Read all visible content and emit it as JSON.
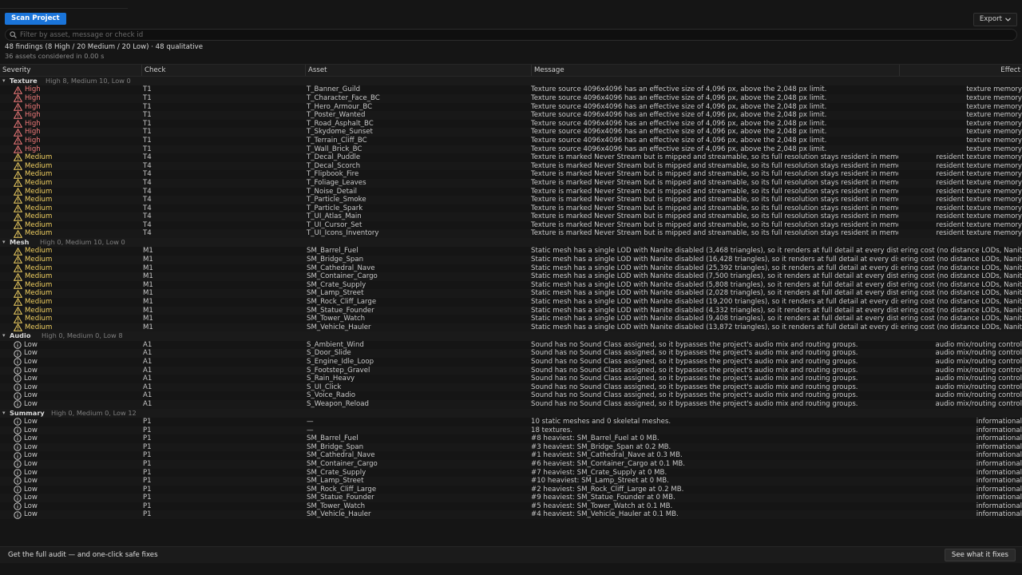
{
  "toolbar": {
    "scan_label": "Scan Project",
    "export_label": "Export"
  },
  "search": {
    "placeholder": "Filter by asset, message or check id"
  },
  "summary": {
    "line1": "48 findings (8 High / 20 Medium / 20 Low) · 48 qualitative",
    "line2": "36 assets considered in 0.00 s"
  },
  "columns": {
    "severity": "Severity",
    "check": "Check",
    "asset": "Asset",
    "message": "Message",
    "effect": "Effect"
  },
  "colors": {
    "high": "#f07a7a",
    "medium": "#f0cf60",
    "low": "#c9c9c9",
    "accent": "#1a74d9"
  },
  "groups": [
    {
      "name": "Texture",
      "counts": "High 8, Medium 10, Low 0",
      "rows": [
        {
          "severity": "High",
          "icon": "warning-triangle-icon",
          "check": "T1",
          "asset": "T_Banner_Guild",
          "message": "Texture source 4096x4096 has an effective size of 4,096 px, above the 2,048 px limit.",
          "effect": "texture memory"
        },
        {
          "severity": "High",
          "icon": "warning-triangle-icon",
          "check": "T1",
          "asset": "T_Character_Face_BC",
          "message": "Texture source 4096x4096 has an effective size of 4,096 px, above the 2,048 px limit.",
          "effect": "texture memory"
        },
        {
          "severity": "High",
          "icon": "warning-triangle-icon",
          "check": "T1",
          "asset": "T_Hero_Armour_BC",
          "message": "Texture source 4096x4096 has an effective size of 4,096 px, above the 2,048 px limit.",
          "effect": "texture memory"
        },
        {
          "severity": "High",
          "icon": "warning-triangle-icon",
          "check": "T1",
          "asset": "T_Poster_Wanted",
          "message": "Texture source 4096x4096 has an effective size of 4,096 px, above the 2,048 px limit.",
          "effect": "texture memory"
        },
        {
          "severity": "High",
          "icon": "warning-triangle-icon",
          "check": "T1",
          "asset": "T_Road_Asphalt_BC",
          "message": "Texture source 4096x4096 has an effective size of 4,096 px, above the 2,048 px limit.",
          "effect": "texture memory"
        },
        {
          "severity": "High",
          "icon": "warning-triangle-icon",
          "check": "T1",
          "asset": "T_Skydome_Sunset",
          "message": "Texture source 4096x4096 has an effective size of 4,096 px, above the 2,048 px limit.",
          "effect": "texture memory"
        },
        {
          "severity": "High",
          "icon": "warning-triangle-icon",
          "check": "T1",
          "asset": "T_Terrain_Cliff_BC",
          "message": "Texture source 4096x4096 has an effective size of 4,096 px, above the 2,048 px limit.",
          "effect": "texture memory"
        },
        {
          "severity": "High",
          "icon": "warning-triangle-icon",
          "check": "T1",
          "asset": "T_Wall_Brick_BC",
          "message": "Texture source 4096x4096 has an effective size of 4,096 px, above the 2,048 px limit.",
          "effect": "texture memory"
        },
        {
          "severity": "Medium",
          "icon": "warning-triangle-icon",
          "check": "T4",
          "asset": "T_Decal_Puddle",
          "message": "Texture is marked Never Stream but is mipped and streamable, so its full resolution stays resident in memory.",
          "effect": "resident texture memory"
        },
        {
          "severity": "Medium",
          "icon": "warning-triangle-icon",
          "check": "T4",
          "asset": "T_Decal_Scorch",
          "message": "Texture is marked Never Stream but is mipped and streamable, so its full resolution stays resident in memory.",
          "effect": "resident texture memory"
        },
        {
          "severity": "Medium",
          "icon": "warning-triangle-icon",
          "check": "T4",
          "asset": "T_Flipbook_Fire",
          "message": "Texture is marked Never Stream but is mipped and streamable, so its full resolution stays resident in memory.",
          "effect": "resident texture memory"
        },
        {
          "severity": "Medium",
          "icon": "warning-triangle-icon",
          "check": "T4",
          "asset": "T_Foliage_Leaves",
          "message": "Texture is marked Never Stream but is mipped and streamable, so its full resolution stays resident in memory.",
          "effect": "resident texture memory"
        },
        {
          "severity": "Medium",
          "icon": "warning-triangle-icon",
          "check": "T4",
          "asset": "T_Noise_Detail",
          "message": "Texture is marked Never Stream but is mipped and streamable, so its full resolution stays resident in memory.",
          "effect": "resident texture memory"
        },
        {
          "severity": "Medium",
          "icon": "warning-triangle-icon",
          "check": "T4",
          "asset": "T_Particle_Smoke",
          "message": "Texture is marked Never Stream but is mipped and streamable, so its full resolution stays resident in memory.",
          "effect": "resident texture memory"
        },
        {
          "severity": "Medium",
          "icon": "warning-triangle-icon",
          "check": "T4",
          "asset": "T_Particle_Spark",
          "message": "Texture is marked Never Stream but is mipped and streamable, so its full resolution stays resident in memory.",
          "effect": "resident texture memory"
        },
        {
          "severity": "Medium",
          "icon": "warning-triangle-icon",
          "check": "T4",
          "asset": "T_UI_Atlas_Main",
          "message": "Texture is marked Never Stream but is mipped and streamable, so its full resolution stays resident in memory.",
          "effect": "resident texture memory"
        },
        {
          "severity": "Medium",
          "icon": "warning-triangle-icon",
          "check": "T4",
          "asset": "T_UI_Cursor_Set",
          "message": "Texture is marked Never Stream but is mipped and streamable, so its full resolution stays resident in memory.",
          "effect": "resident texture memory"
        },
        {
          "severity": "Medium",
          "icon": "warning-triangle-icon",
          "check": "T4",
          "asset": "T_UI_Icons_Inventory",
          "message": "Texture is marked Never Stream but is mipped and streamable, so its full resolution stays resident in memory.",
          "effect": "resident texture memory"
        }
      ]
    },
    {
      "name": "Mesh",
      "counts": "High 0, Medium 10, Low 0",
      "rows": [
        {
          "severity": "Medium",
          "icon": "warning-triangle-icon",
          "check": "M1",
          "asset": "SM_Barrel_Fuel",
          "message": "Static mesh has a single LOD with Nanite disabled (3,468 triangles), so it renders at full detail at every distance.",
          "effect": "ering cost (no distance LODs, Nanite off)"
        },
        {
          "severity": "Medium",
          "icon": "warning-triangle-icon",
          "check": "M1",
          "asset": "SM_Bridge_Span",
          "message": "Static mesh has a single LOD with Nanite disabled (16,428 triangles), so it renders at full detail at every distance.",
          "effect": "ering cost (no distance LODs, Nanite off)"
        },
        {
          "severity": "Medium",
          "icon": "warning-triangle-icon",
          "check": "M1",
          "asset": "SM_Cathedral_Nave",
          "message": "Static mesh has a single LOD with Nanite disabled (25,392 triangles), so it renders at full detail at every distance.",
          "effect": "ering cost (no distance LODs, Nanite off)"
        },
        {
          "severity": "Medium",
          "icon": "warning-triangle-icon",
          "check": "M1",
          "asset": "SM_Container_Cargo",
          "message": "Static mesh has a single LOD with Nanite disabled (7,500 triangles), so it renders at full detail at every distance.",
          "effect": "ering cost (no distance LODs, Nanite off)"
        },
        {
          "severity": "Medium",
          "icon": "warning-triangle-icon",
          "check": "M1",
          "asset": "SM_Crate_Supply",
          "message": "Static mesh has a single LOD with Nanite disabled (5,808 triangles), so it renders at full detail at every distance.",
          "effect": "ering cost (no distance LODs, Nanite off)"
        },
        {
          "severity": "Medium",
          "icon": "warning-triangle-icon",
          "check": "M1",
          "asset": "SM_Lamp_Street",
          "message": "Static mesh has a single LOD with Nanite disabled (2,028 triangles), so it renders at full detail at every distance.",
          "effect": "ering cost (no distance LODs, Nanite off)"
        },
        {
          "severity": "Medium",
          "icon": "warning-triangle-icon",
          "check": "M1",
          "asset": "SM_Rock_Cliff_Large",
          "message": "Static mesh has a single LOD with Nanite disabled (19,200 triangles), so it renders at full detail at every distance.",
          "effect": "ering cost (no distance LODs, Nanite off)"
        },
        {
          "severity": "Medium",
          "icon": "warning-triangle-icon",
          "check": "M1",
          "asset": "SM_Statue_Founder",
          "message": "Static mesh has a single LOD with Nanite disabled (4,332 triangles), so it renders at full detail at every distance.",
          "effect": "ering cost (no distance LODs, Nanite off)"
        },
        {
          "severity": "Medium",
          "icon": "warning-triangle-icon",
          "check": "M1",
          "asset": "SM_Tower_Watch",
          "message": "Static mesh has a single LOD with Nanite disabled (9,408 triangles), so it renders at full detail at every distance.",
          "effect": "ering cost (no distance LODs, Nanite off)"
        },
        {
          "severity": "Medium",
          "icon": "warning-triangle-icon",
          "check": "M1",
          "asset": "SM_Vehicle_Hauler",
          "message": "Static mesh has a single LOD with Nanite disabled (13,872 triangles), so it renders at full detail at every distance.",
          "effect": "ering cost (no distance LODs, Nanite off)"
        }
      ]
    },
    {
      "name": "Audio",
      "counts": "High 0, Medium 0, Low 8",
      "rows": [
        {
          "severity": "Low",
          "icon": "info-circle-icon",
          "check": "A1",
          "asset": "S_Ambient_Wind",
          "message": "Sound has no Sound Class assigned, so it bypasses the project's audio mix and routing groups.",
          "effect": "audio mix/routing control"
        },
        {
          "severity": "Low",
          "icon": "info-circle-icon",
          "check": "A1",
          "asset": "S_Door_Slide",
          "message": "Sound has no Sound Class assigned, so it bypasses the project's audio mix and routing groups.",
          "effect": "audio mix/routing control"
        },
        {
          "severity": "Low",
          "icon": "info-circle-icon",
          "check": "A1",
          "asset": "S_Engine_Idle_Loop",
          "message": "Sound has no Sound Class assigned, so it bypasses the project's audio mix and routing groups.",
          "effect": "audio mix/routing control"
        },
        {
          "severity": "Low",
          "icon": "info-circle-icon",
          "check": "A1",
          "asset": "S_Footstep_Gravel",
          "message": "Sound has no Sound Class assigned, so it bypasses the project's audio mix and routing groups.",
          "effect": "audio mix/routing control"
        },
        {
          "severity": "Low",
          "icon": "info-circle-icon",
          "check": "A1",
          "asset": "S_Rain_Heavy",
          "message": "Sound has no Sound Class assigned, so it bypasses the project's audio mix and routing groups.",
          "effect": "audio mix/routing control"
        },
        {
          "severity": "Low",
          "icon": "info-circle-icon",
          "check": "A1",
          "asset": "S_UI_Click",
          "message": "Sound has no Sound Class assigned, so it bypasses the project's audio mix and routing groups.",
          "effect": "audio mix/routing control"
        },
        {
          "severity": "Low",
          "icon": "info-circle-icon",
          "check": "A1",
          "asset": "S_Voice_Radio",
          "message": "Sound has no Sound Class assigned, so it bypasses the project's audio mix and routing groups.",
          "effect": "audio mix/routing control"
        },
        {
          "severity": "Low",
          "icon": "info-circle-icon",
          "check": "A1",
          "asset": "S_Weapon_Reload",
          "message": "Sound has no Sound Class assigned, so it bypasses the project's audio mix and routing groups.",
          "effect": "audio mix/routing control"
        }
      ]
    },
    {
      "name": "Summary",
      "counts": "High 0, Medium 0, Low 12",
      "rows": [
        {
          "severity": "Low",
          "icon": "info-circle-icon",
          "check": "P1",
          "asset": "—",
          "message": "10 static meshes and 0 skeletal meshes.",
          "effect": "informational"
        },
        {
          "severity": "Low",
          "icon": "info-circle-icon",
          "check": "P1",
          "asset": "—",
          "message": "18 textures.",
          "effect": "informational"
        },
        {
          "severity": "Low",
          "icon": "info-circle-icon",
          "check": "P1",
          "asset": "SM_Barrel_Fuel",
          "message": "#8 heaviest: SM_Barrel_Fuel at 0 MB.",
          "effect": "informational"
        },
        {
          "severity": "Low",
          "icon": "info-circle-icon",
          "check": "P1",
          "asset": "SM_Bridge_Span",
          "message": "#3 heaviest: SM_Bridge_Span at 0.2 MB.",
          "effect": "informational"
        },
        {
          "severity": "Low",
          "icon": "info-circle-icon",
          "check": "P1",
          "asset": "SM_Cathedral_Nave",
          "message": "#1 heaviest: SM_Cathedral_Nave at 0.3 MB.",
          "effect": "informational"
        },
        {
          "severity": "Low",
          "icon": "info-circle-icon",
          "check": "P1",
          "asset": "SM_Container_Cargo",
          "message": "#6 heaviest: SM_Container_Cargo at 0.1 MB.",
          "effect": "informational"
        },
        {
          "severity": "Low",
          "icon": "info-circle-icon",
          "check": "P1",
          "asset": "SM_Crate_Supply",
          "message": "#7 heaviest: SM_Crate_Supply at 0 MB.",
          "effect": "informational"
        },
        {
          "severity": "Low",
          "icon": "info-circle-icon",
          "check": "P1",
          "asset": "SM_Lamp_Street",
          "message": "#10 heaviest: SM_Lamp_Street at 0 MB.",
          "effect": "informational"
        },
        {
          "severity": "Low",
          "icon": "info-circle-icon",
          "check": "P1",
          "asset": "SM_Rock_Cliff_Large",
          "message": "#2 heaviest: SM_Rock_Cliff_Large at 0.2 MB.",
          "effect": "informational"
        },
        {
          "severity": "Low",
          "icon": "info-circle-icon",
          "check": "P1",
          "asset": "SM_Statue_Founder",
          "message": "#9 heaviest: SM_Statue_Founder at 0 MB.",
          "effect": "informational"
        },
        {
          "severity": "Low",
          "icon": "info-circle-icon",
          "check": "P1",
          "asset": "SM_Tower_Watch",
          "message": "#5 heaviest: SM_Tower_Watch at 0.1 MB.",
          "effect": "informational"
        },
        {
          "severity": "Low",
          "icon": "info-circle-icon",
          "check": "P1",
          "asset": "SM_Vehicle_Hauler",
          "message": "#4 heaviest: SM_Vehicle_Hauler at 0.1 MB.",
          "effect": "informational"
        }
      ]
    }
  ],
  "footer": {
    "text": "Get the full audit — and one-click safe fixes",
    "button_label": "See what it fixes"
  }
}
